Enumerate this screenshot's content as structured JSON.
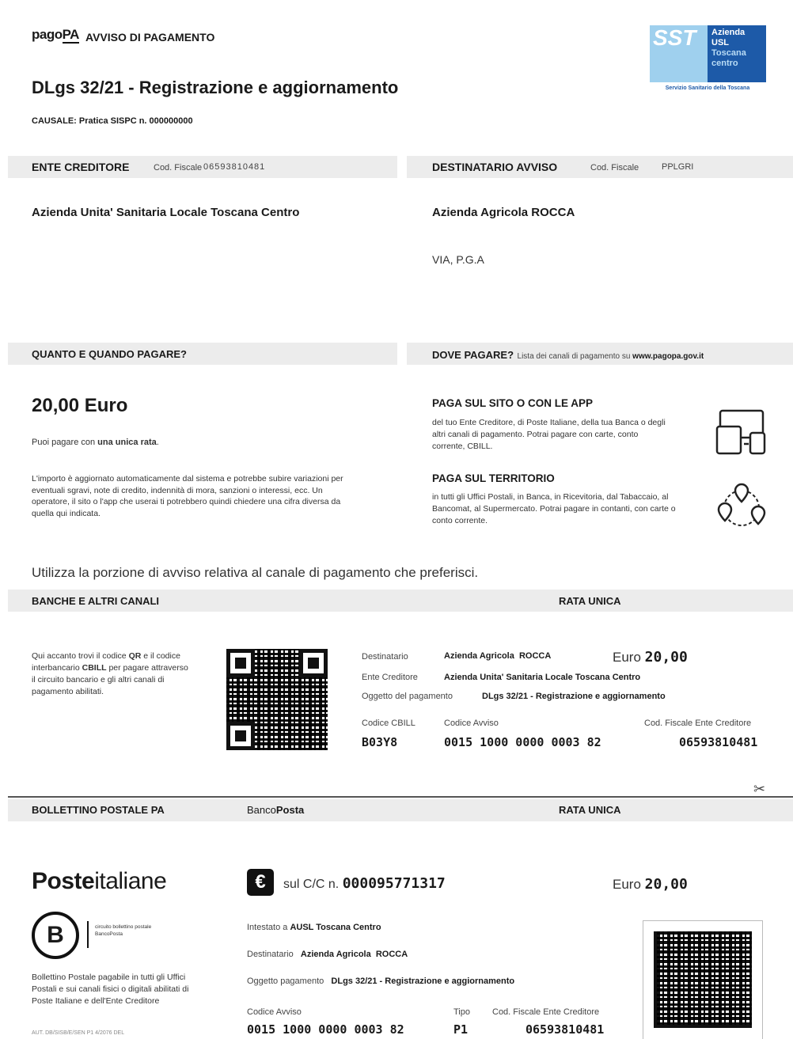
{
  "header": {
    "logo_pago": "pago",
    "logo_pa": "PA",
    "notice_title": "AVVISO DI PAGAMENTO",
    "subject": "DLgs 32/21 - Registrazione e aggiornamento",
    "causale": "CAUSALE: Pratica SISPC n. 000000000",
    "usl_badge": {
      "sst": "SST",
      "lines": [
        "Azienda",
        "USL",
        "Toscana",
        "centro"
      ],
      "footer": "Servizio Sanitario della Toscana"
    }
  },
  "ente": {
    "heading": "ENTE CREDITORE",
    "cf_label": "Cod. Fiscale",
    "cf_value": "06593810481",
    "name": "Azienda Unita' Sanitaria Locale Toscana Centro"
  },
  "destinatario": {
    "heading": "DESTINATARIO AVVISO",
    "cf_label": "Cod. Fiscale",
    "cf_value": "PPLGRI",
    "name": "Azienda Agricola  ROCCA",
    "address": "VIA, P.G.A"
  },
  "quanto": {
    "heading": "QUANTO E QUANDO PAGARE?",
    "amount": "20,00 Euro",
    "rata_prefix": "Puoi pagare con ",
    "rata_bold": "una unica rata",
    "rata_suffix": ".",
    "note": "L'importo è aggiornato automaticamente dal sistema e potrebbe subire variazioni per eventuali sgravi, note di credito, indennità di mora, sanzioni o interessi, ecc. Un operatore, il sito o l'app che userai ti potrebbero quindi chiedere una cifra diversa da quella qui indicata."
  },
  "dove": {
    "heading": "DOVE PAGARE?",
    "sub": "Lista dei canali di pagamento su ",
    "site": "www.pagopa.gov.it",
    "online_title": "PAGA SUL SITO O CON LE APP",
    "online_text": "del tuo Ente Creditore, di Poste Italiane, della tua Banca o degli altri canali di pagamento. Potrai pagare con carte, conto corrente, CBILL.",
    "territory_title": "PAGA SUL TERRITORIO",
    "territory_text": "in tutti gli Uffici Postali, in Banca, in Ricevitoria, dal Tabaccaio, al Bancomat, al Supermercato. Potrai pagare in contanti, con carte o conto corrente."
  },
  "instruction": "Utilizza la porzione di avviso relativa al canale di pagamento che preferisci.",
  "banche": {
    "heading": "BANCHE E ALTRI CANALI",
    "rata": "RATA UNICA",
    "desc_1": "Qui accanto trovi il codice ",
    "desc_qr": "QR",
    "desc_2": " e il codice interbancario ",
    "desc_cbill": "CBILL",
    "desc_3": " per pagare attraverso il circuito bancario e gli altri canali di pagamento abilitati.",
    "dest_label": "Destinatario",
    "dest_value": "Azienda Agricola  ROCCA",
    "euro_label": "Euro",
    "euro_value": "20,00",
    "ente_label": "Ente Creditore",
    "ente_value": "Azienda Unita' Sanitaria Locale Toscana Centro",
    "oggetto_label": "Oggetto del pagamento",
    "oggetto_value": "DLgs 32/21 - Registrazione e aggiornamento",
    "cbill_label": "Codice CBILL",
    "cbill_value": "B03Y8",
    "avviso_label": "Codice Avviso",
    "avviso_value": "0015 1000 0000 0003 82",
    "cf_label": "Cod. Fiscale Ente Creditore",
    "cf_value": "06593810481"
  },
  "bollettino": {
    "heading": "BOLLETTINO POSTALE PA",
    "banco_1": "Banco",
    "banco_2": "Posta",
    "rata": "RATA UNICA",
    "poste_1": "Poste",
    "poste_2": "italiane",
    "b_badge": "B",
    "b_caption": "circuito bollettino postale BancoPosta",
    "desc": "Bollettino Postale pagabile in tutti gli Uffici Postali e sui canali fisici o digitali abilitati di Poste Italiane e dell'Ente Creditore",
    "aut": "AUT. DB/SISB/E/SEN P1 4/2076 DEL",
    "euro_symbol": "€",
    "cc_label": "sul C/C n.",
    "cc_value": "000095771317",
    "euro_label": "Euro",
    "euro_value": "20,00",
    "intestato_label": "Intestato a",
    "intestato_value": "AUSL Toscana Centro",
    "dest_label": "Destinatario",
    "dest_value": "Azienda Agricola  ROCCA",
    "oggetto_label": "Oggetto pagamento",
    "oggetto_value": "DLgs 32/21 - Registrazione e aggiornamento",
    "avviso_label": "Codice Avviso",
    "avviso_value": "0015 1000 0000 0003 82",
    "tipo_label": "Tipo",
    "tipo_value": "P1",
    "cf_label": "Cod. Fiscale Ente Creditore",
    "cf_value": "06593810481"
  },
  "icons": [
    "scissors-icon",
    "devices-icon",
    "map-pins-icon",
    "euro-icon"
  ],
  "colors": {
    "band": "#ececec",
    "pagopa_blue": "#0d4ea3",
    "usl_blue": "#1d5aa8"
  }
}
